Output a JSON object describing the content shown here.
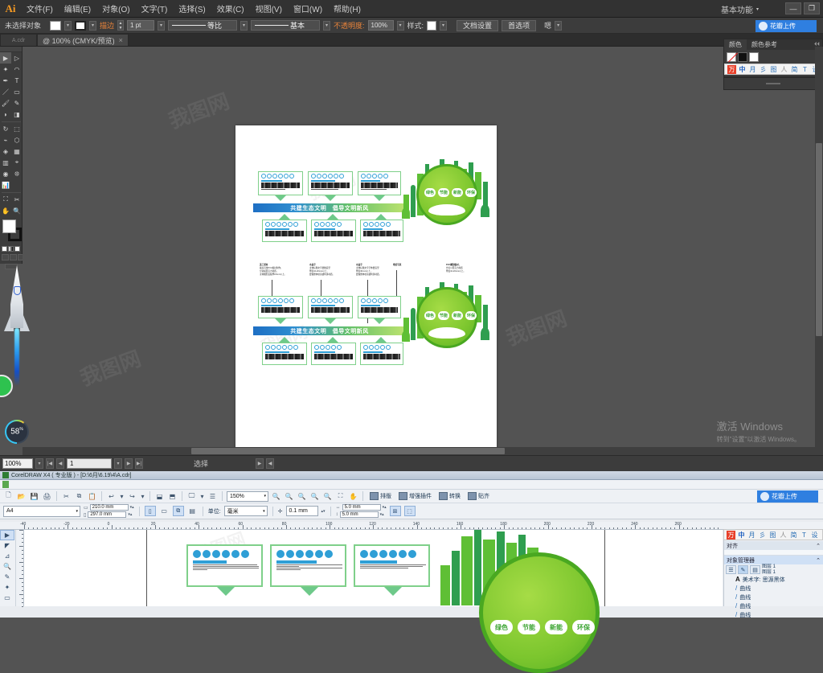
{
  "ai": {
    "app_logo": "Ai",
    "menus": [
      "文件(F)",
      "编辑(E)",
      "对象(O)",
      "文字(T)",
      "选择(S)",
      "效果(C)",
      "视图(V)",
      "窗口(W)",
      "帮助(H)"
    ],
    "workspace": "基本功能",
    "win_buttons": [
      "—",
      "❐"
    ],
    "options": {
      "selection_status": "未选择对象",
      "stroke_label": "描边",
      "stroke_weight": "1 pt",
      "profile_label": "等比",
      "brush_label": "基本",
      "opacity_label": "不透明度:",
      "opacity_value": "100%",
      "style_label": "样式:",
      "doc_setup": "文档设置",
      "preferences": "首选项",
      "extra": "嗯"
    },
    "tab": {
      "title": "@ 100% (CMYK/预览)",
      "close": "×",
      "ghost": "A.cdr"
    },
    "upload_button": "花瓣上传",
    "panels": {
      "color_tab": "颜色",
      "color_guide_tab": "颜色参考",
      "collapse": "⏴⏴",
      "strip_icons": [
        "万",
        "中",
        "月",
        "彡",
        "图",
        "人",
        "简",
        "T",
        "设"
      ]
    },
    "statusbar": {
      "zoom": "100%",
      "page": "1",
      "status_text": "选择"
    },
    "artwork": {
      "banner_text": "共建生态文明　倡导文明新风",
      "globe_pills": [
        "绿色",
        "节能",
        "新能",
        "环保"
      ],
      "callouts": [
        {
          "title": "美工纸材",
          "body": "裱好可用PVC板材制作，\n分别裱亚克力材质，\n主体图形底板厚15mm以上。"
        },
        {
          "title": "水晶字",
          "body": "主体标题文字要做造型\n厚度10-20mm以上，\n要做整体喷涂或烤漆材质。"
        },
        {
          "title": "水晶字",
          "body": "主体标题文字字体要造型\n厚度30mm以上，\n要做整体喷涂或烤漆材质。"
        },
        {
          "title": "喷绘写真",
          "body": ""
        },
        {
          "title": "PVC雕刻板材，",
          "body": "也可以亚克力材质\n厚度10-20mm以上。"
        }
      ]
    },
    "overlays": {
      "percent": "58",
      "percent_unit": "%",
      "windows_activate_title": "激活 Windows",
      "windows_activate_sub": "转到\"设置\"以激活 Windows。"
    }
  },
  "coreldraw": {
    "title": "CorelDRAW X4 ( 专业版 ) - [D:\\6月\\6.19\\4\\A.cdr]",
    "upload_button": "花瓣上传",
    "toolbar": {
      "zoom": "150%",
      "buttons": [
        "排版",
        "增强插件",
        "转换",
        "贴齐"
      ]
    },
    "properties": {
      "page_size": "A4",
      "width": "210.0 mm",
      "height": "297.0 mm",
      "unit_label": "单位:",
      "unit_value": "毫米",
      "nudge": "0.1 mm",
      "duplicate_x": "5.0 mm",
      "duplicate_y": "5.0 mm"
    },
    "ruler_labels": [
      "-40",
      "-20",
      "0",
      "20",
      "40",
      "60",
      "80",
      "100",
      "120",
      "140",
      "160",
      "180",
      "200",
      "220",
      "240",
      "260"
    ],
    "dock": {
      "align_title": "对齐",
      "object_manager_title": "对象管理器",
      "layer_line1": "图层 1",
      "layer_line2": "图层 1",
      "items": [
        {
          "icon": "A",
          "label": "美术字: 思源黑体"
        },
        {
          "icon": "/",
          "label": "曲线"
        },
        {
          "icon": "/",
          "label": "曲线"
        },
        {
          "icon": "/",
          "label": "曲线"
        },
        {
          "icon": "/",
          "label": "曲线"
        }
      ]
    },
    "artwork": {
      "globe_pills": [
        "绿色",
        "节能",
        "新能",
        "环保"
      ]
    }
  }
}
